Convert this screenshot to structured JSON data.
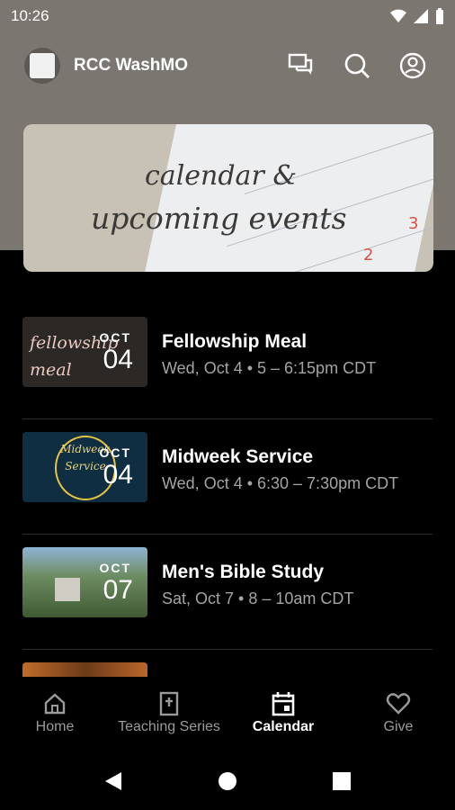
{
  "status_bar": {
    "time": "10:26"
  },
  "app": {
    "title": "RCC WashMO"
  },
  "banner": {
    "line1": "calendar &",
    "line2": "upcoming events",
    "num1": "2",
    "num2": "3"
  },
  "events": [
    {
      "title": "Fellowship Meal",
      "meta": "Wed, Oct 4 • 5 – 6:15pm CDT",
      "month": "OCT",
      "day": "04",
      "thumb_text": "fellowship meal"
    },
    {
      "title": "Midweek Service",
      "meta": "Wed, Oct 4 • 6:30 – 7:30pm CDT",
      "month": "OCT",
      "day": "04",
      "thumb_text": "Midweek Service"
    },
    {
      "title": "Men's Bible Study",
      "meta": "Sat, Oct 7 • 8 – 10am CDT",
      "month": "OCT",
      "day": "07"
    }
  ],
  "bottom_nav": [
    {
      "label": "Home",
      "icon": "home-icon"
    },
    {
      "label": "Teaching Series",
      "icon": "bible-icon"
    },
    {
      "label": "Calendar",
      "icon": "calendar-icon",
      "active": true
    },
    {
      "label": "Give",
      "icon": "heart-icon"
    }
  ],
  "colors": {
    "header_bg": "#7b7670",
    "page_bg": "#000000",
    "meta_text": "#a4a4a4"
  }
}
